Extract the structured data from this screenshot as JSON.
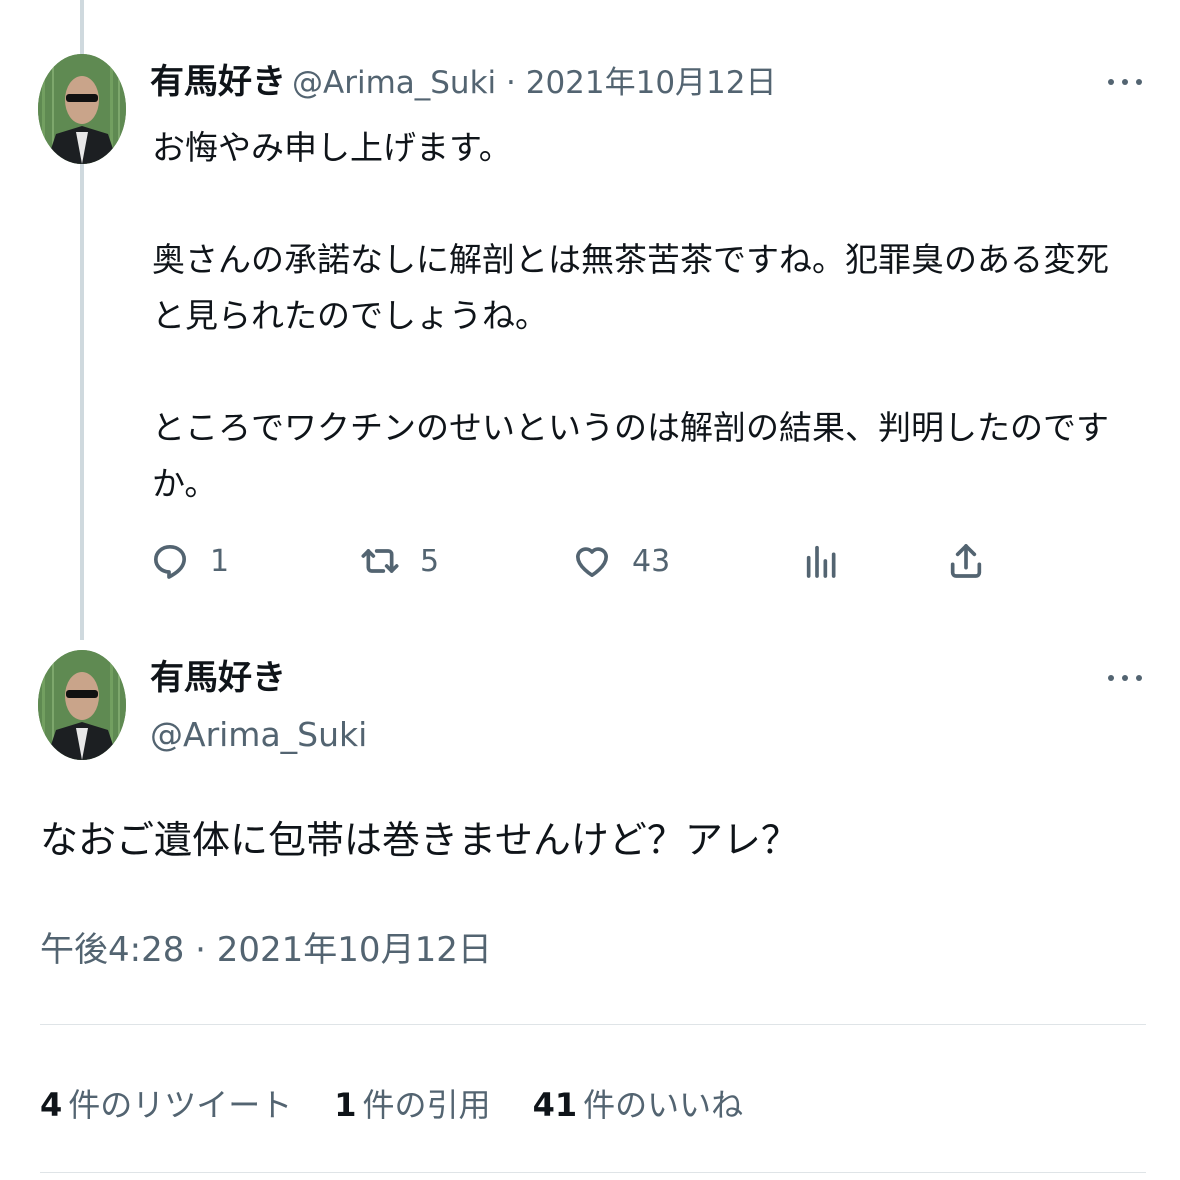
{
  "reply_tweet": {
    "display_name": "有馬好き",
    "handle": "@Arima_Suki",
    "separator": " · ",
    "date": "2021年10月12日",
    "text": "お悔やみ申し上げます。\n\n奥さんの承諾なしに解剖とは無茶苦茶ですね。犯罪臭のある変死\nと見られたのでしょうね。\n\nところでワクチンのせいというのは解剖の結果、判明したのです\nか。",
    "actions": {
      "reply_count": "1",
      "retweet_count": "5",
      "like_count": "43"
    }
  },
  "main_tweet": {
    "display_name": "有馬好き",
    "handle": "@Arima_Suki",
    "text": "なおご遺体に包帯は巻きませんけど？アレ？",
    "timestamp": "午後4:28 · 2021年10月12日",
    "stats": {
      "retweets_num": "4",
      "retweets_label": "件のリツイート",
      "quotes_num": "1",
      "quotes_label": "件の引用",
      "likes_num": "41",
      "likes_label": "件のいいね"
    }
  },
  "colors": {
    "text_primary": "#0f1419",
    "text_secondary": "#536471",
    "thread_line": "#cfd9de",
    "divider": "#dfe4e7"
  },
  "icons": [
    "more-icon",
    "reply-icon",
    "retweet-icon",
    "like-icon",
    "analytics-icon",
    "share-icon"
  ]
}
